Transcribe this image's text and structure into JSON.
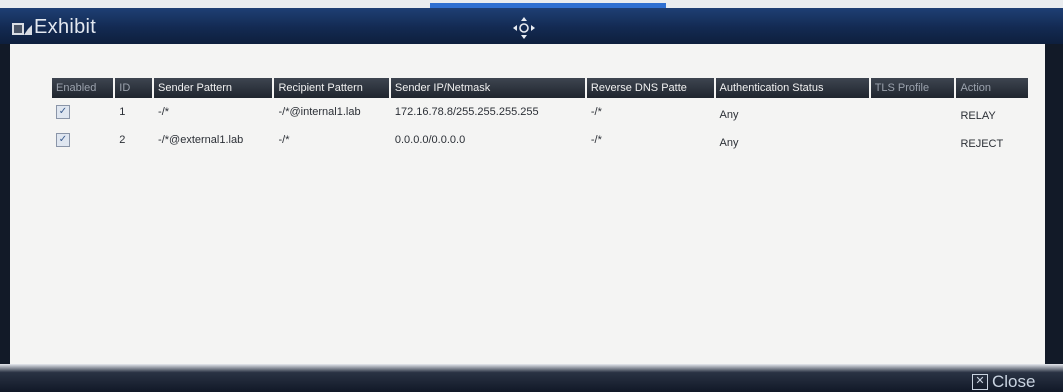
{
  "window": {
    "title": "Exhibit"
  },
  "table": {
    "columns": [
      "Enabled",
      "ID",
      "Sender Pattern",
      "Recipient Pattern",
      "Sender IP/Netmask",
      "Reverse DNS Patte",
      "Authentication Status",
      "TLS Profile",
      "Action"
    ],
    "rows": [
      {
        "enabled": true,
        "id": "1",
        "sender_pattern": "-/*",
        "recipient_pattern": "-/*@internal1.lab",
        "sender_ip": "172.16.78.8/255.255.255.255",
        "reverse_dns": "-/*",
        "auth_status": "Any",
        "tls_profile": "",
        "action": "RELAY"
      },
      {
        "enabled": true,
        "id": "2",
        "sender_pattern": "-/*@external1.lab",
        "recipient_pattern": "-/*",
        "sender_ip": "0.0.0.0/0.0.0.0",
        "reverse_dns": "-/*",
        "auth_status": "Any",
        "tls_profile": "",
        "action": "REJECT"
      }
    ]
  },
  "footer": {
    "close_label": "Close"
  },
  "icons": {
    "window": "window-icon",
    "move": "move-icon",
    "checkbox": "checkmark-icon",
    "close": "close-icon"
  },
  "colors": {
    "title_bar": "#132a52",
    "header": "#2b313a",
    "content_bg": "#f4f4f3"
  }
}
